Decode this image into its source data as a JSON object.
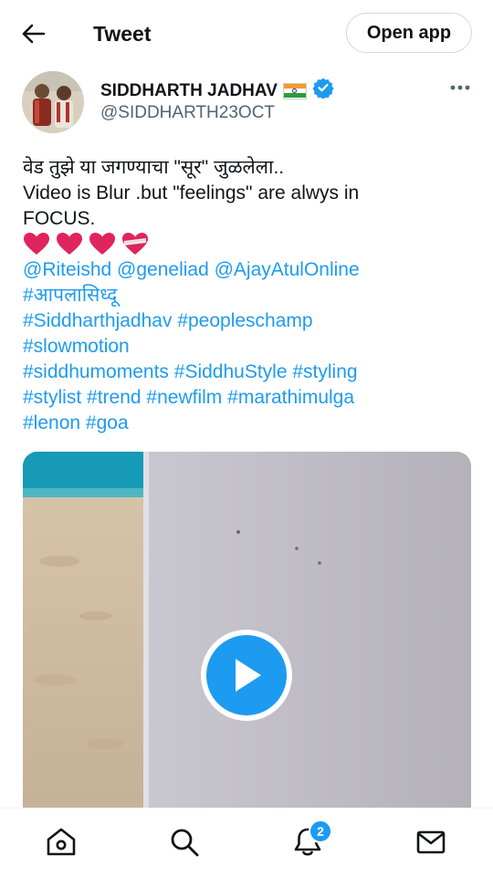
{
  "header": {
    "title": "Tweet",
    "open_app_label": "Open app"
  },
  "author": {
    "name": "SIDDHARTH JADHAV",
    "handle": "@SIDDHARTH23OCT",
    "verified": true,
    "flag": "india-flag"
  },
  "tweet": {
    "line1": "वेड तुझे या जगण्याचा \"सूर\" जुळलेला..",
    "line2": "Video is Blur .but \"feelings\" are alwys in",
    "line3": "FOCUS.",
    "emoji": [
      "❤️",
      "❤️",
      "❤️",
      "❤️‍🩹"
    ],
    "mentions": [
      "@Riteishd",
      "@geneliad",
      "@AjayAtulOnline"
    ],
    "hashtag_lines": [
      [
        "#आपलासिध्दू"
      ],
      [
        "#Siddharthjadhav",
        "#peopleschamp"
      ],
      [
        "#slowmotion"
      ],
      [
        "#siddhumoments",
        "#SiddhuStyle",
        "#styling"
      ],
      [
        "#stylist",
        "#trend",
        "#newfilm",
        "#marathimulga"
      ],
      [
        "#lenon",
        "#goa"
      ]
    ]
  },
  "colors": {
    "accent": "#1d9bf0",
    "text": "#0f1419",
    "muted": "#536471",
    "heart": "#e0245e"
  },
  "icons": {
    "back": "back-arrow-icon",
    "more": "more-icon",
    "play": "play-icon",
    "nav": [
      "home-icon",
      "search-icon",
      "notifications-icon",
      "messages-icon"
    ]
  },
  "nav": {
    "notification_count": "2"
  }
}
